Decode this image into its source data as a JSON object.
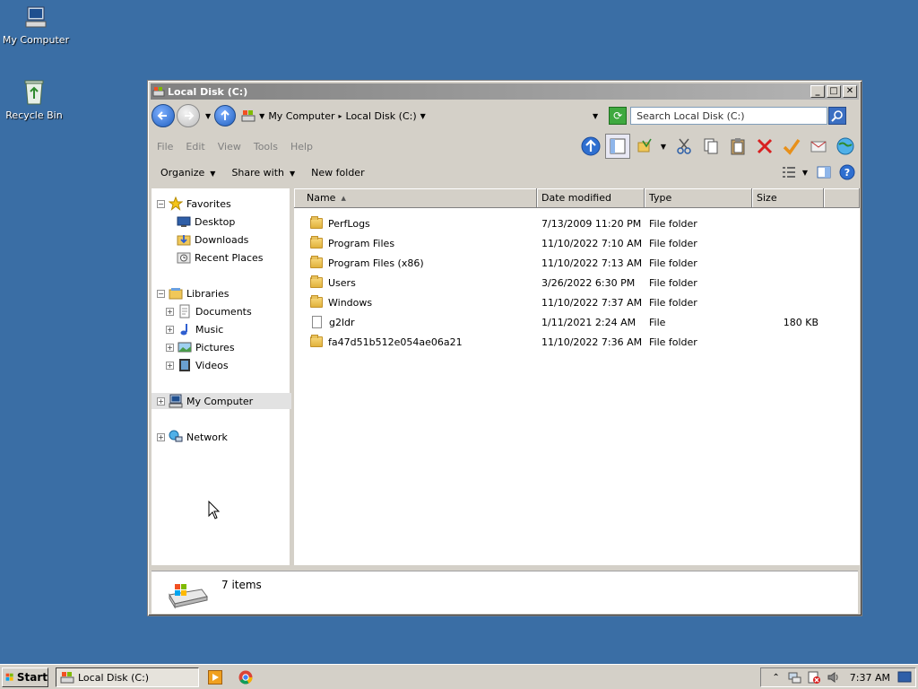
{
  "desktop": {
    "icons": [
      {
        "label": "My Computer"
      },
      {
        "label": "Recycle Bin"
      }
    ]
  },
  "window": {
    "title": "Local Disk (C:)",
    "address": {
      "crumbs": [
        "My Computer",
        "Local Disk (C:)"
      ]
    },
    "search_placeholder": "Search Local Disk (C:)",
    "menu": [
      "File",
      "Edit",
      "View",
      "Tools",
      "Help"
    ],
    "commands": {
      "organize": "Organize",
      "share_with": "Share with",
      "new_folder": "New folder"
    },
    "nav": {
      "favorites": "Favorites",
      "desktop": "Desktop",
      "downloads": "Downloads",
      "recent_places": "Recent Places",
      "libraries": "Libraries",
      "documents": "Documents",
      "music": "Music",
      "pictures": "Pictures",
      "videos": "Videos",
      "my_computer": "My Computer",
      "network": "Network"
    },
    "columns": {
      "name": "Name",
      "date": "Date modified",
      "type": "Type",
      "size": "Size"
    },
    "files": [
      {
        "name": "PerfLogs",
        "date": "7/13/2009 11:20 PM",
        "type": "File folder",
        "size": "",
        "kind": "folder"
      },
      {
        "name": "Program Files",
        "date": "11/10/2022 7:10 AM",
        "type": "File folder",
        "size": "",
        "kind": "folder"
      },
      {
        "name": "Program Files (x86)",
        "date": "11/10/2022 7:13 AM",
        "type": "File folder",
        "size": "",
        "kind": "folder"
      },
      {
        "name": "Users",
        "date": "3/26/2022 6:30 PM",
        "type": "File folder",
        "size": "",
        "kind": "folder"
      },
      {
        "name": "Windows",
        "date": "11/10/2022 7:37 AM",
        "type": "File folder",
        "size": "",
        "kind": "folder"
      },
      {
        "name": "g2ldr",
        "date": "1/11/2021 2:24 AM",
        "type": "File",
        "size": "180 KB",
        "kind": "file"
      },
      {
        "name": "fa47d51b512e054ae06a21",
        "date": "11/10/2022 7:36 AM",
        "type": "File folder",
        "size": "",
        "kind": "folder"
      }
    ],
    "status": {
      "count": "7 items"
    }
  },
  "taskbar": {
    "start": "Start",
    "task": "Local Disk (C:)",
    "clock": "7:37 AM"
  }
}
